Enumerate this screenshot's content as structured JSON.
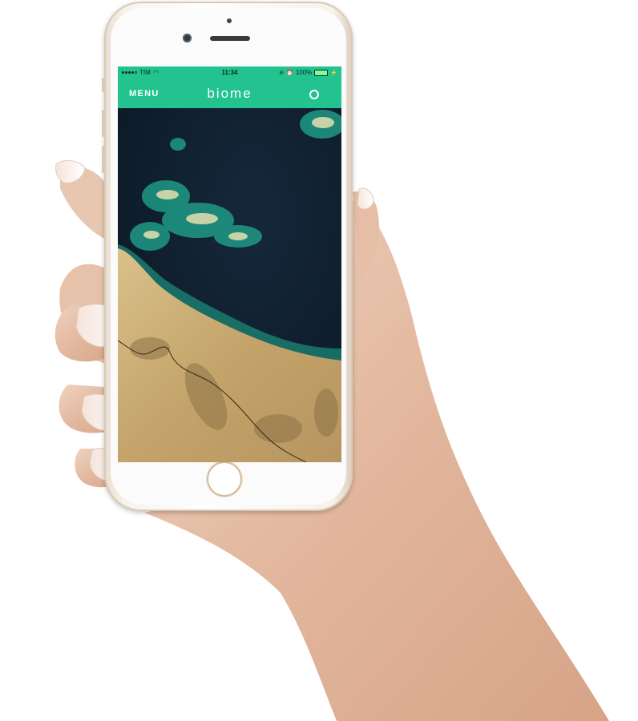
{
  "status_bar": {
    "carrier": "TIM",
    "time": "11:34",
    "battery": "100%"
  },
  "app_bar": {
    "menu_label": "MENU",
    "title": "biome"
  },
  "colors": {
    "brand": "#22c38f",
    "ocean": "#101f2e",
    "land": "#cdb27a"
  },
  "icons": {
    "signal": "signal-dots-icon",
    "wifi": "wifi-icon",
    "search": "search-icon",
    "alarm": "alarm-icon",
    "lock": "orientation-lock-icon",
    "battery": "battery-icon"
  }
}
